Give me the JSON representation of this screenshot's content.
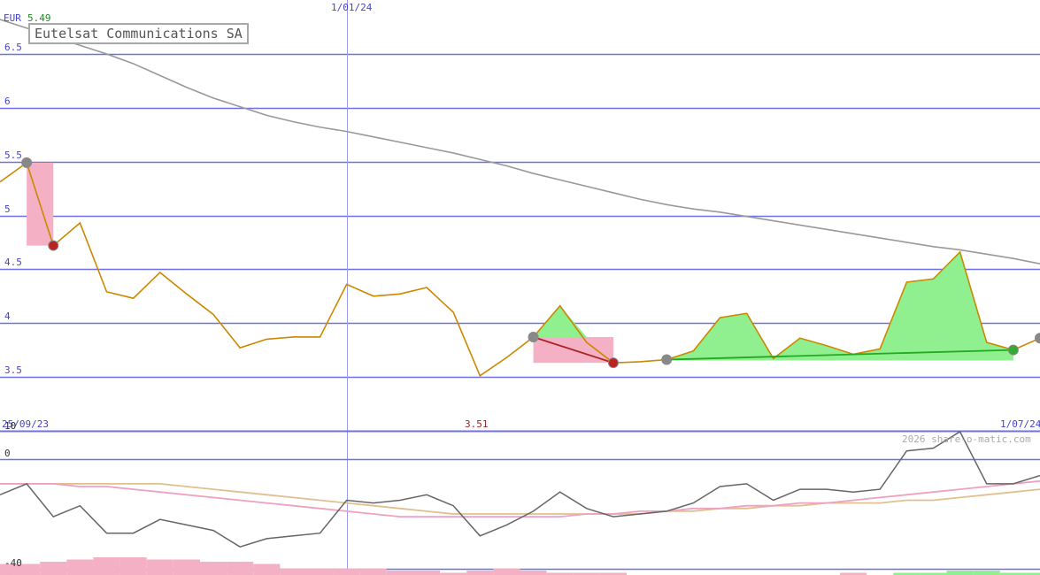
{
  "header": {
    "currency": "EUR",
    "last_price": "5.49",
    "title": "Eutelsat Communications SA",
    "min_label": "3.51",
    "copyright": "2026 share-o-matic.com"
  },
  "colors": {
    "grid": "#6f6fe8",
    "axis_text": "#4444cc",
    "price": "#cc8800",
    "moving_average": "#999999",
    "gain": "#90f090",
    "loss": "#f4b0c4",
    "trend_up": "#22aa22",
    "trend_down": "#aa2222",
    "osc_line": "#666666",
    "osc_pink": "#f0a0c0",
    "osc_tan": "#e0c090"
  },
  "chart_data": [
    {
      "type": "line",
      "title": "Eutelsat Communications SA",
      "ylabel": "EUR",
      "ylim": [
        3.02,
        6.82
      ],
      "yticks": [
        "3.5",
        "4",
        "4.5",
        "5",
        "5.5",
        "6",
        "6.5"
      ],
      "x_tick_labels": [
        "25/09/23",
        "1/01/24",
        "1/07/24"
      ],
      "grid": true,
      "series": [
        {
          "role": "price",
          "values": [
            5.31,
            5.49,
            4.72,
            4.93,
            4.29,
            4.23,
            4.47,
            4.27,
            4.08,
            3.77,
            3.85,
            3.87,
            3.87,
            4.36,
            4.25,
            4.27,
            4.33,
            4.1,
            3.51,
            3.68,
            3.87,
            4.16,
            3.82,
            3.63,
            3.64,
            3.66,
            3.74,
            4.05,
            4.09,
            3.67,
            3.86,
            3.79,
            3.71,
            3.76,
            4.38,
            4.41,
            4.66,
            3.82,
            3.75,
            3.86
          ]
        },
        {
          "role": "moving-average",
          "values": [
            6.82,
            6.74,
            6.66,
            6.58,
            6.5,
            6.41,
            6.3,
            6.19,
            6.09,
            6.01,
            5.93,
            5.87,
            5.82,
            5.78,
            5.73,
            5.68,
            5.63,
            5.58,
            5.52,
            5.46,
            5.39,
            5.33,
            5.27,
            5.21,
            5.15,
            5.1,
            5.06,
            5.03,
            4.99,
            4.95,
            4.91,
            4.87,
            4.83,
            4.79,
            4.75,
            4.71,
            4.68,
            4.64,
            4.6,
            4.55
          ]
        }
      ],
      "signals": [
        {
          "kind": "sell",
          "from_index": 1,
          "to_index": 2,
          "from_value": 5.49,
          "to_value": 4.72
        },
        {
          "kind": "sell",
          "from_index": 20,
          "to_index": 23,
          "from_value": 3.87,
          "to_value": 3.63
        },
        {
          "kind": "buy",
          "from_index": 25,
          "to_index": 38,
          "from_value": 3.66,
          "to_value": 3.75
        }
      ],
      "marker_index": 39
    },
    {
      "type": "line",
      "ylim": [
        -40,
        10
      ],
      "yticks": [
        "10",
        "0",
        "-40"
      ],
      "grid": true,
      "series": [
        {
          "role": "oscillator",
          "values": [
            -13,
            -9,
            -21,
            -17,
            -27,
            -27,
            -22,
            -24,
            -26,
            -32,
            -29,
            -28,
            -27,
            -15,
            -16,
            -15,
            -13,
            -17,
            -28,
            -24,
            -19,
            -12,
            -18,
            -21,
            -20,
            -19,
            -16,
            -10,
            -9,
            -15,
            -11,
            -11,
            -12,
            -11,
            3,
            4,
            10,
            -9,
            -9,
            -6
          ]
        },
        {
          "role": "signal-pink",
          "values": [
            -9,
            -9,
            -9,
            -10,
            -10,
            -11,
            -12,
            -13,
            -14,
            -15,
            -16,
            -17,
            -18,
            -19,
            -20,
            -21,
            -21,
            -21,
            -21,
            -21,
            -21,
            -21,
            -20,
            -20,
            -19,
            -19,
            -18,
            -18,
            -17,
            -17,
            -16,
            -16,
            -15,
            -14,
            -13,
            -12,
            -11,
            -10,
            -9,
            -8
          ]
        },
        {
          "role": "signal-tan",
          "values": [
            -9,
            -9,
            -9,
            -9,
            -9,
            -9,
            -9,
            -10,
            -11,
            -12,
            -13,
            -14,
            -15,
            -16,
            -17,
            -18,
            -19,
            -20,
            -20,
            -20,
            -20,
            -20,
            -20,
            -20,
            -20,
            -19,
            -19,
            -18,
            -18,
            -17,
            -17,
            -16,
            -16,
            -16,
            -15,
            -15,
            -14,
            -13,
            -12,
            -11
          ]
        }
      ],
      "histogram": [
        -5,
        -5,
        -6,
        -7,
        -8,
        -8,
        -7,
        -7,
        -6,
        -6,
        -5,
        -3,
        -3,
        -3,
        -3,
        -2,
        -2,
        -1,
        -2,
        -3,
        -2,
        -1,
        -1,
        -1,
        0,
        0,
        0,
        0,
        0,
        0,
        0,
        0,
        -1,
        0,
        1,
        1,
        2,
        2,
        1,
        1
      ]
    }
  ]
}
